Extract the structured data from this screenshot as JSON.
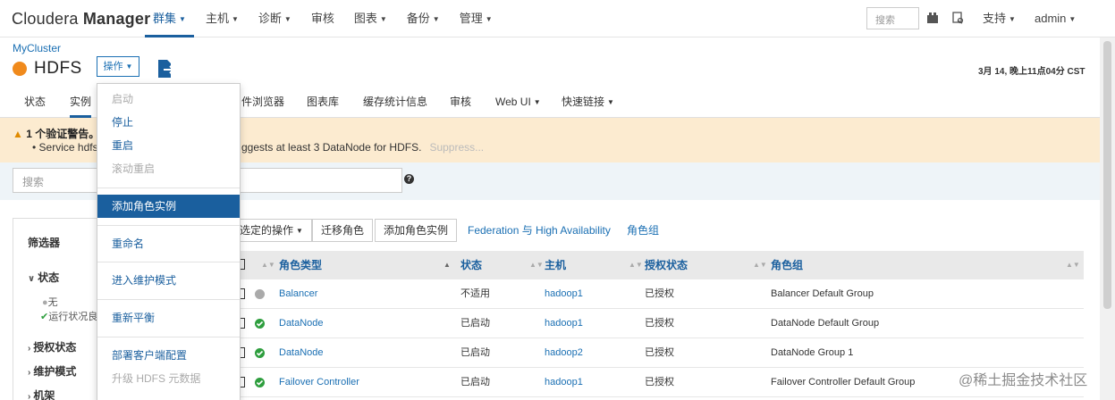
{
  "brand": {
    "light": "Cloudera ",
    "bold": "Manager"
  },
  "nav": [
    {
      "label": "群集"
    },
    {
      "label": "主机"
    },
    {
      "label": "诊断"
    },
    {
      "label": "审核"
    },
    {
      "label": "图表"
    },
    {
      "label": "备份"
    },
    {
      "label": "管理"
    }
  ],
  "top": {
    "search_placeholder": "搜索",
    "support": "支持",
    "user": "admin"
  },
  "header": {
    "cluster": "MyCluster",
    "service": "HDFS",
    "actions_label": "操作",
    "timestamp": "3月 14, 晚上11点04分 CST",
    "status_color": "#f08a1c"
  },
  "tabs": [
    {
      "label": "状态"
    },
    {
      "label": "实例"
    },
    {
      "label": "件浏览器"
    },
    {
      "label": "图表库"
    },
    {
      "label": "缓存统计信息"
    },
    {
      "label": "审核"
    },
    {
      "label": "Web UI"
    },
    {
      "label": "快速链接"
    }
  ],
  "warning": {
    "title": "1 个验证警告。",
    "line_start": "Service hdfs",
    "line_end": "ggests at least 3 DataNode for HDFS.",
    "suppress": "Suppress..."
  },
  "filter": {
    "search_placeholder": "搜索"
  },
  "filter_panel": {
    "title": "筛选器",
    "sections": [
      {
        "label": "状态"
      },
      {
        "label": "授权状态"
      },
      {
        "label": "维护模式"
      },
      {
        "label": "机架"
      }
    ],
    "options": [
      "无",
      "运行状况良"
    ]
  },
  "toolbar": {
    "selected_actions": "选定的操作",
    "migrate": "迁移角色",
    "add_instances": "添加角色实例",
    "federation": "Federation 与 High Availability",
    "role_groups": "角色组"
  },
  "table": {
    "headers": [
      "角色类型",
      "状态",
      "主机",
      "授权状态",
      "角色组"
    ],
    "rows": [
      {
        "status_icon": "gray-circle",
        "role": "Balancer",
        "state": "不适用",
        "host": "hadoop1",
        "auth": "已授权",
        "group": "Balancer Default Group"
      },
      {
        "status_icon": "green-check",
        "role": "DataNode",
        "state": "已启动",
        "host": "hadoop1",
        "auth": "已授权",
        "group": "DataNode Default Group"
      },
      {
        "status_icon": "green-check",
        "role": "DataNode",
        "state": "已启动",
        "host": "hadoop2",
        "auth": "已授权",
        "group": "DataNode Group 1"
      },
      {
        "status_icon": "green-check",
        "role": "Failover Controller",
        "state": "已启动",
        "host": "hadoop1",
        "auth": "已授权",
        "group": "Failover Controller Default Group"
      }
    ]
  },
  "menu": [
    {
      "label": "启动",
      "disabled": true
    },
    {
      "label": "停止",
      "disabled": false
    },
    {
      "label": "重启",
      "disabled": false
    },
    {
      "label": "滚动重启",
      "disabled": true
    },
    {
      "label": "添加角色实例",
      "highlighted": true
    },
    {
      "label": "重命名",
      "disabled": false
    },
    {
      "label": "进入维护模式",
      "disabled": false
    },
    {
      "label": "重新平衡",
      "disabled": false
    },
    {
      "label": "部署客户端配置",
      "disabled": false
    },
    {
      "label": "升级 HDFS 元数据",
      "disabled": true
    }
  ],
  "watermark": "@稀土掘金技术社区"
}
